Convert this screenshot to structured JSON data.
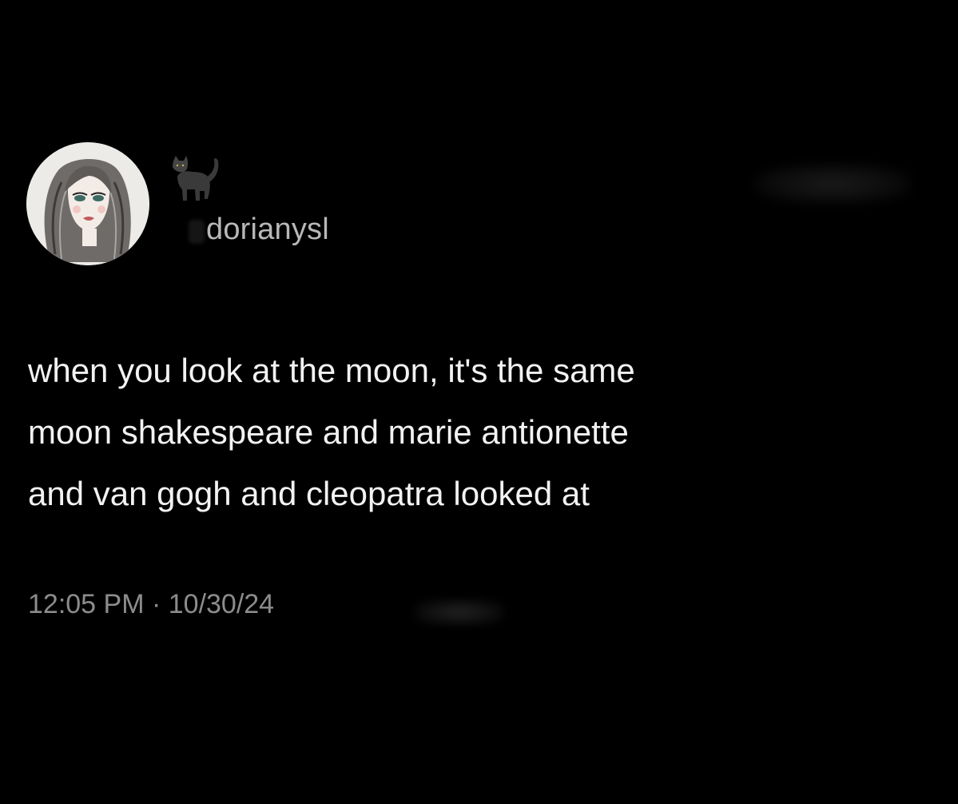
{
  "author": {
    "avatar_icon": "avatar-illustration",
    "name_icon": "black-cat-icon",
    "handle": "dorianysl"
  },
  "tweet": {
    "text_lines": [
      "when you look at the moon, it's the same",
      "moon shakespeare and marie antionette",
      "and van gogh and cleopatra looked at"
    ],
    "timestamp": "12:05 PM · 10/30/24"
  },
  "colors": {
    "background": "#000000",
    "text": "#f2f2f2",
    "secondary_text": "#8c8c8c"
  }
}
